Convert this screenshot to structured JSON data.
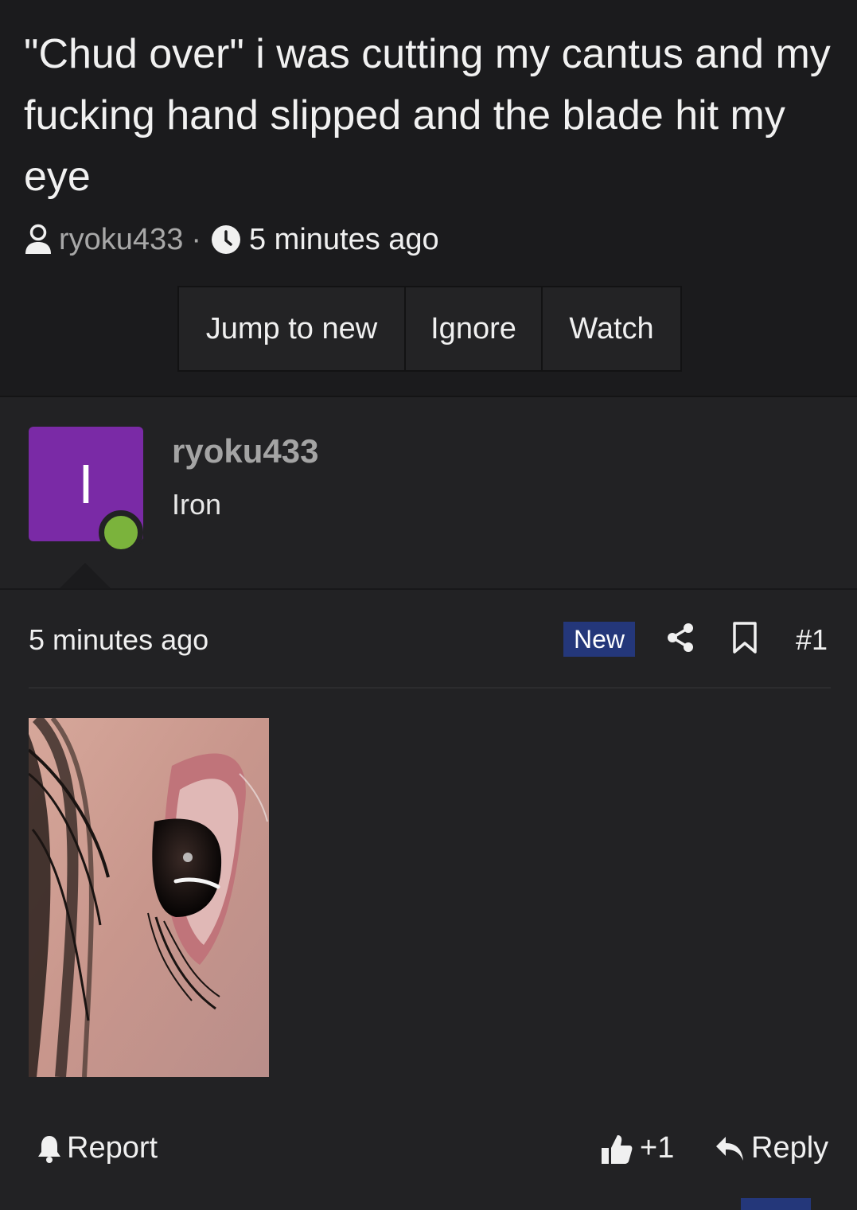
{
  "thread": {
    "title": "\"Chud over\" i was cutting my cantus and my fucking hand slipped and the blade hit my eye",
    "author": "ryoku433",
    "separator": "·",
    "time": "5 minutes ago",
    "buttons": {
      "jump_to_new": "Jump to new",
      "ignore": "Ignore",
      "watch": "Watch"
    }
  },
  "post": {
    "avatar_letter": "I",
    "username": "ryoku433",
    "rank": "Iron",
    "time": "5 minutes ago",
    "badge": "New",
    "number": "#1",
    "attachment_icon": "eye-photo",
    "actions": {
      "report": "Report",
      "like": "+1",
      "reply": "Reply"
    }
  },
  "colors": {
    "background": "#1b1b1d",
    "post_background": "#222224",
    "avatar": "#7a2aa6",
    "online": "#7bb33c",
    "badge": "#24377a"
  }
}
